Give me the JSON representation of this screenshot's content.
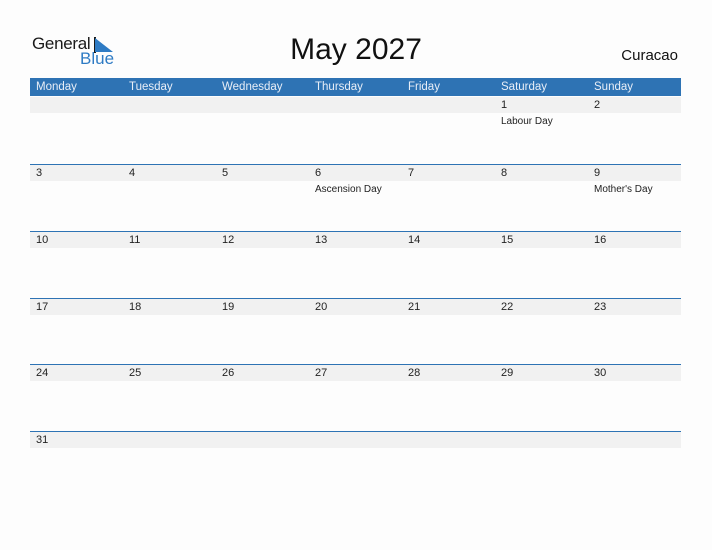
{
  "logo": {
    "general": "General",
    "blue": "Blue"
  },
  "title": "May 2027",
  "country": "Curacao",
  "weekdays": [
    "Monday",
    "Tuesday",
    "Wednesday",
    "Thursday",
    "Friday",
    "Saturday",
    "Sunday"
  ],
  "weeks": [
    [
      {
        "d": ""
      },
      {
        "d": ""
      },
      {
        "d": ""
      },
      {
        "d": ""
      },
      {
        "d": ""
      },
      {
        "d": "1",
        "e": "Labour Day"
      },
      {
        "d": "2"
      }
    ],
    [
      {
        "d": "3"
      },
      {
        "d": "4"
      },
      {
        "d": "5"
      },
      {
        "d": "6",
        "e": "Ascension Day"
      },
      {
        "d": "7"
      },
      {
        "d": "8"
      },
      {
        "d": "9",
        "e": "Mother's Day"
      }
    ],
    [
      {
        "d": "10"
      },
      {
        "d": "11"
      },
      {
        "d": "12"
      },
      {
        "d": "13"
      },
      {
        "d": "14"
      },
      {
        "d": "15"
      },
      {
        "d": "16"
      }
    ],
    [
      {
        "d": "17"
      },
      {
        "d": "18"
      },
      {
        "d": "19"
      },
      {
        "d": "20"
      },
      {
        "d": "21"
      },
      {
        "d": "22"
      },
      {
        "d": "23"
      }
    ],
    [
      {
        "d": "24"
      },
      {
        "d": "25"
      },
      {
        "d": "26"
      },
      {
        "d": "27"
      },
      {
        "d": "28"
      },
      {
        "d": "29"
      },
      {
        "d": "30"
      }
    ],
    [
      {
        "d": "31"
      },
      {
        "d": ""
      },
      {
        "d": ""
      },
      {
        "d": ""
      },
      {
        "d": ""
      },
      {
        "d": ""
      },
      {
        "d": ""
      }
    ]
  ],
  "colors": {
    "accent": "#2e73b4",
    "logo_blue": "#2e7bc4"
  }
}
